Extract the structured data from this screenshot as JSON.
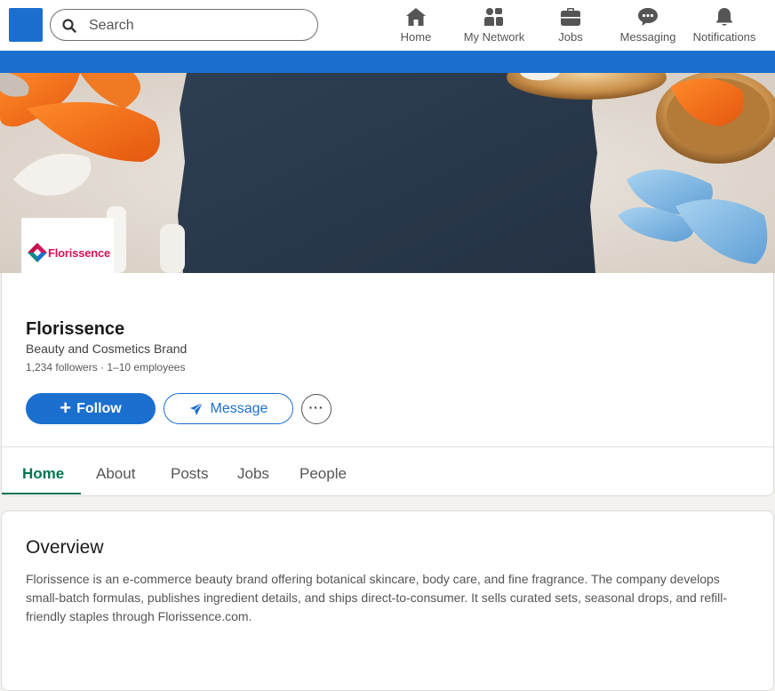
{
  "topnav": {
    "search_placeholder": "Search",
    "items": [
      {
        "label": "Home",
        "icon": "home-icon"
      },
      {
        "label": "My Network",
        "icon": "network-icon"
      },
      {
        "label": "Jobs",
        "icon": "briefcase-icon"
      },
      {
        "label": "Messaging",
        "icon": "messaging-icon"
      },
      {
        "label": "Notifications",
        "icon": "bell-icon"
      }
    ]
  },
  "company": {
    "logo_text": "Florissence",
    "name": "Florissence",
    "tagline": "Beauty and Cosmetics Brand",
    "meta": "1,234 followers · 1–10 employees"
  },
  "actions": {
    "follow_label": "Follow",
    "message_label": "Message",
    "more_label": "···"
  },
  "tabs": [
    {
      "label": "Home",
      "active": true
    },
    {
      "label": "About",
      "active": false
    },
    {
      "label": "Posts",
      "active": false
    },
    {
      "label": "Jobs",
      "active": false
    },
    {
      "label": "People",
      "active": false
    }
  ],
  "overview": {
    "title": "Overview",
    "body": "Florissence is an e-commerce beauty brand offering botanical skincare, body care, and fine fragrance. The company develops small-batch formulas, publishes ingredient details, and ships direct-to-consumer. It sells curated sets, seasonal drops, and refill-friendly staples through Florissence.com."
  },
  "colors": {
    "primary": "#1b6fcf",
    "active_tab": "#01754f",
    "logo_red": "#d4145a"
  }
}
